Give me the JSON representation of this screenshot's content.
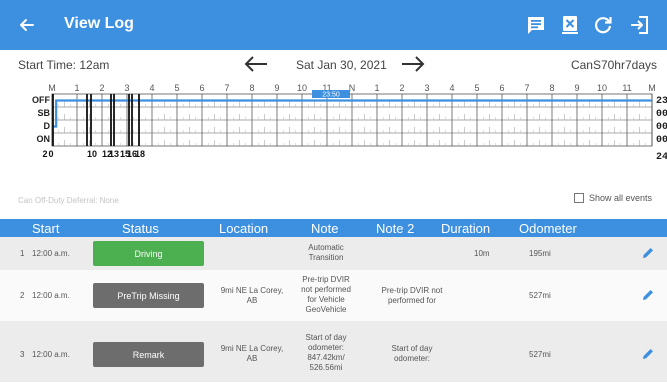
{
  "appbar": {
    "title": "View Log",
    "icons": [
      "back-arrow-icon",
      "edit-log-icon",
      "delete-log-icon",
      "refresh-icon",
      "exit-icon"
    ],
    "color": "#3d8fe0"
  },
  "nav": {
    "start_time": "Start Time: 12am",
    "date": "Sat Jan 30, 2021",
    "cycle": "CanS70hr7days"
  },
  "graph": {
    "hour_labels": [
      "M",
      "1",
      "2",
      "3",
      "4",
      "5",
      "6",
      "7",
      "8",
      "9",
      "10",
      "11",
      "N",
      "1",
      "2",
      "3",
      "4",
      "5",
      "6",
      "7",
      "8",
      "9",
      "10",
      "11",
      "M"
    ],
    "status_labels": [
      "OFF",
      "SB",
      "D",
      "ON"
    ],
    "totals": [
      "23:50",
      "00:00",
      "00:10",
      "00:00"
    ],
    "grand_total": "24:00",
    "current_badge": "23:50",
    "event_labels": [
      "2",
      "0",
      "10",
      "12",
      "13",
      "15",
      "16",
      "18"
    ],
    "line_color": "#3d8fe0"
  },
  "deferral": "Can Off-Duty Deferral: None",
  "show_all_events": "Show all events",
  "table": {
    "headers": [
      "Start",
      "Status",
      "Location",
      "Note",
      "Note 2",
      "Duration",
      "Odometer"
    ],
    "rows": [
      {
        "num": "1",
        "start": "12:00 a.m.",
        "status": "Driving",
        "status_color": "#4caf50",
        "location": "",
        "note": [
          "Automatic",
          "Transition"
        ],
        "note2": [],
        "duration": "10m",
        "odometer": "195mi"
      },
      {
        "num": "2",
        "start": "12:00 a.m.",
        "status": "PreTrip Missing",
        "status_color": "#6d6d6d",
        "location": [
          "9mi NE La Corey,",
          "AB"
        ],
        "note": [
          "Pre-trip DVIR",
          "not performed",
          "for Vehicle",
          "GeoVehicle"
        ],
        "note2": [
          "Pre-trip DVIR not",
          "performed for"
        ],
        "duration": "",
        "odometer": "527mi"
      },
      {
        "num": "3",
        "start": "12:00 a.m.",
        "status": "Remark",
        "status_color": "#6d6d6d",
        "location": [
          "9mi NE La Corey,",
          "AB"
        ],
        "note": [
          "Start of day",
          "odometer:",
          "847.42km/",
          "526.56mi"
        ],
        "note2": [
          "Start of day",
          "odometer:"
        ],
        "duration": "",
        "odometer": "527mi"
      }
    ]
  }
}
